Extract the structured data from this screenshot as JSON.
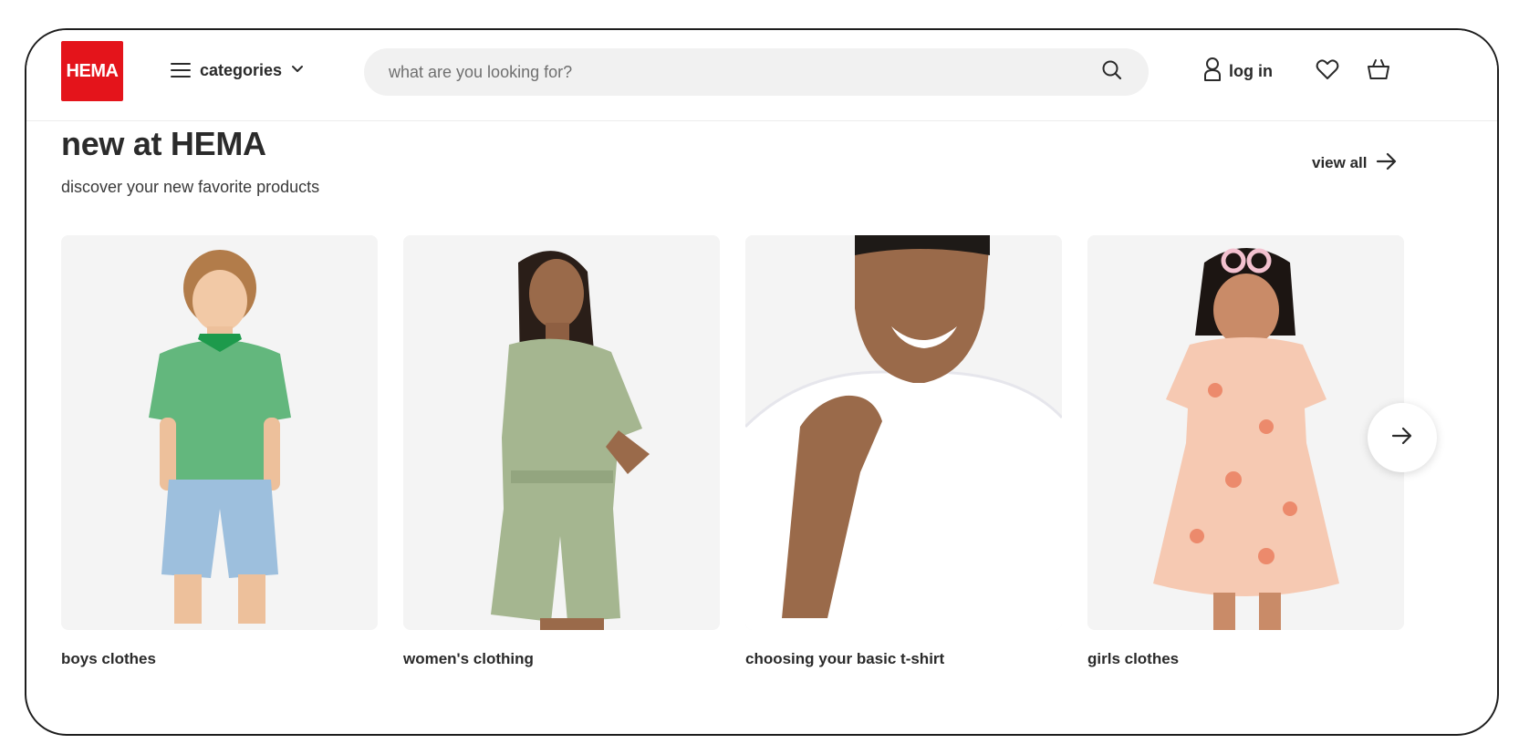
{
  "header": {
    "logo_text": "HEMA",
    "categories_label": "categories",
    "search_placeholder": "what are you looking for?",
    "login_label": "log in",
    "icons": [
      "hamburger-icon",
      "chevron-down-icon",
      "search-icon",
      "user-icon",
      "heart-icon",
      "basket-icon"
    ],
    "brand_color": "#e4141b"
  },
  "section": {
    "title": "new at HEMA",
    "subtitle": "discover your new favorite products",
    "view_all_label": "view all"
  },
  "cards": [
    {
      "caption": "boys clothes"
    },
    {
      "caption": "women's clothing"
    },
    {
      "caption": "choosing your basic t-shirt"
    },
    {
      "caption": "girls clothes"
    }
  ],
  "carousel": {
    "next_icon": "arrow-right-icon"
  }
}
